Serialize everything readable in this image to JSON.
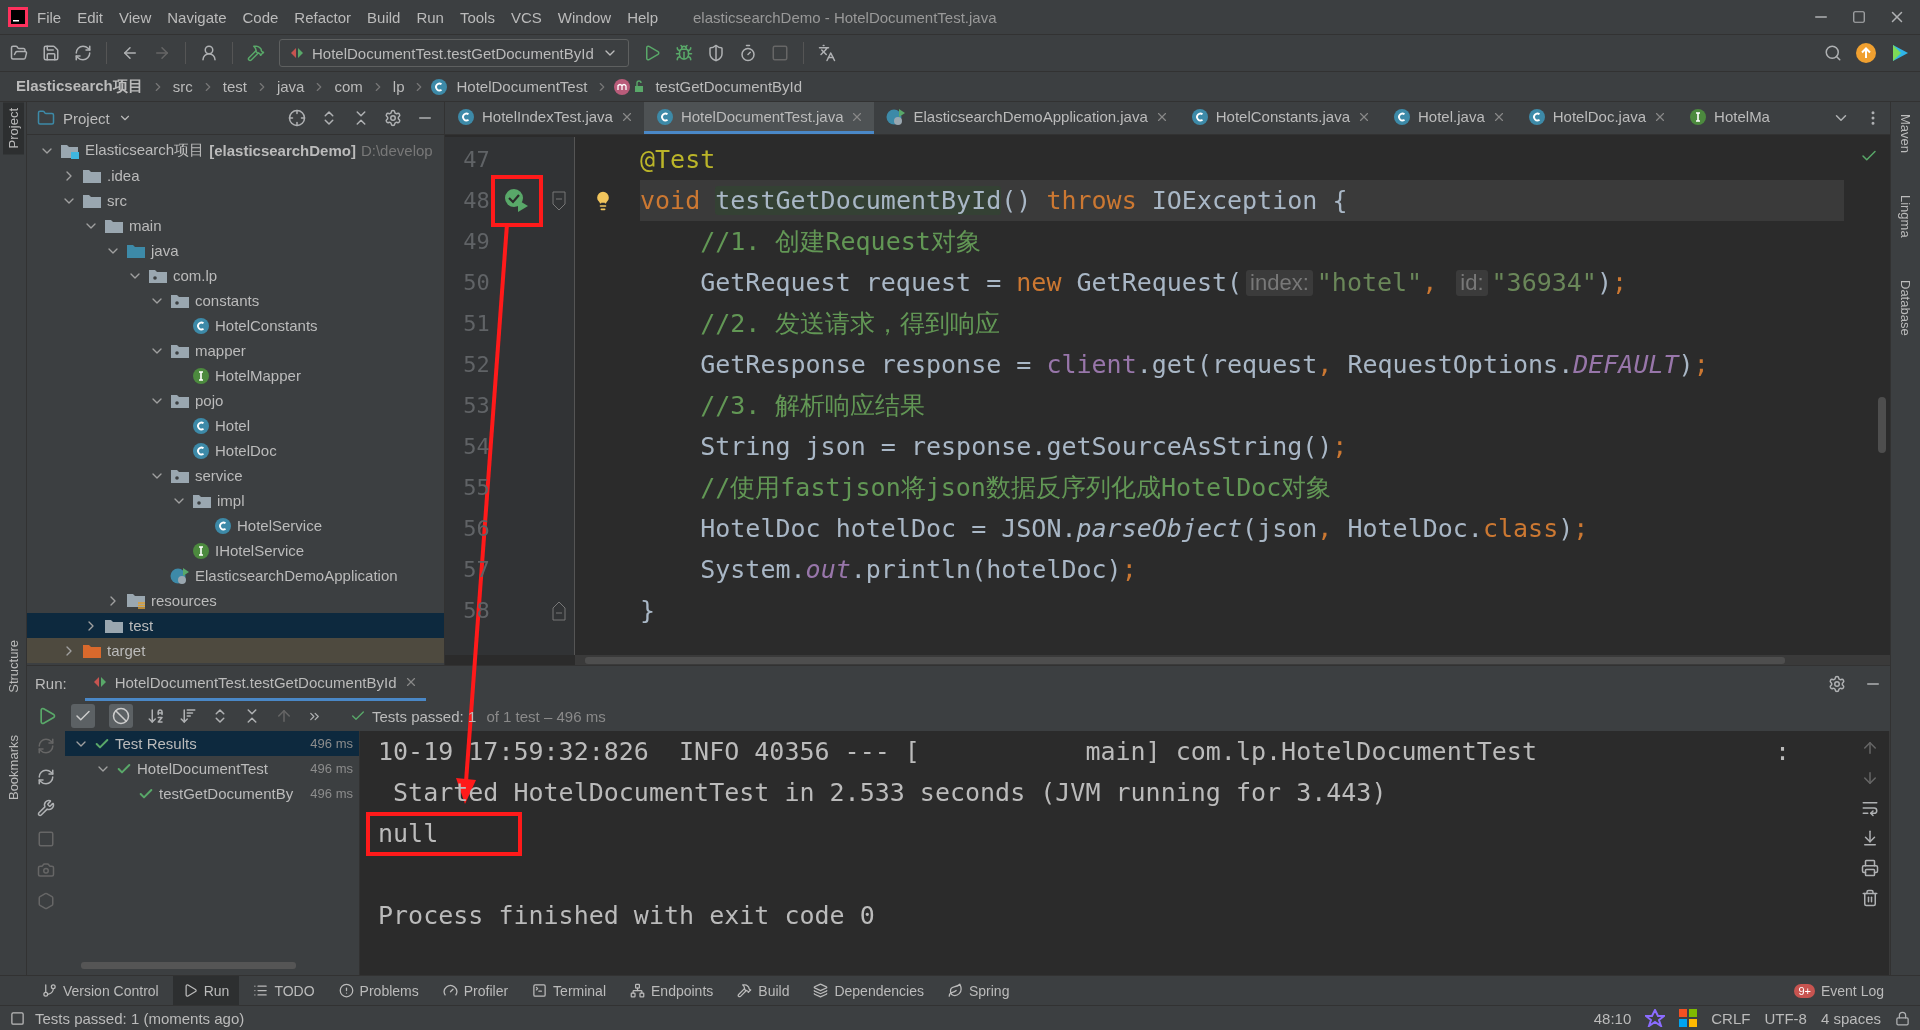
{
  "menu": [
    "File",
    "Edit",
    "View",
    "Navigate",
    "Code",
    "Refactor",
    "Build",
    "Run",
    "Tools",
    "VCS",
    "Window",
    "Help"
  ],
  "window": {
    "title": "elasticsearchDemo - HotelDocumentTest.java"
  },
  "toolbar": {
    "run_config": "HotelDocumentTest.testGetDocumentById"
  },
  "breadcrumb": [
    {
      "label": "Elasticsearch项目",
      "kind": "project"
    },
    {
      "label": "src",
      "kind": "dir"
    },
    {
      "label": "test",
      "kind": "dir"
    },
    {
      "label": "java",
      "kind": "dir"
    },
    {
      "label": "com",
      "kind": "dir"
    },
    {
      "label": "lp",
      "kind": "dir"
    },
    {
      "label": "HotelDocumentTest",
      "kind": "class"
    },
    {
      "label": "testGetDocumentById",
      "kind": "method"
    }
  ],
  "left_stripe": [
    {
      "label": "Project",
      "selected": true
    },
    {
      "label": "Structure",
      "selected": false
    },
    {
      "label": "Bookmarks",
      "selected": false
    }
  ],
  "right_stripe": [
    "Maven",
    "Lingma",
    "Database"
  ],
  "project": {
    "title": "Project",
    "tree": [
      {
        "label": "Elasticsearch项目",
        "module": "[elasticsearchDemo]",
        "path": "D:\\develop",
        "kind": "module",
        "expanded": true,
        "selected": false,
        "children": [
          {
            "label": ".idea",
            "kind": "folder",
            "expanded": false,
            "selected": false
          },
          {
            "label": "src",
            "kind": "folder",
            "expanded": true,
            "selected": false,
            "children": [
              {
                "label": "main",
                "kind": "folder",
                "expanded": true,
                "selected": false,
                "children": [
                  {
                    "label": "java",
                    "kind": "source",
                    "expanded": true,
                    "selected": false,
                    "children": [
                      {
                        "label": "com.lp",
                        "kind": "package",
                        "expanded": true,
                        "selected": false,
                        "children": [
                          {
                            "label": "constants",
                            "kind": "package",
                            "expanded": true,
                            "selected": false,
                            "children": [
                              {
                                "label": "HotelConstants",
                                "kind": "class",
                                "selected": false
                              }
                            ]
                          },
                          {
                            "label": "mapper",
                            "kind": "package",
                            "expanded": true,
                            "selected": false,
                            "children": [
                              {
                                "label": "HotelMapper",
                                "kind": "interface",
                                "selected": false
                              }
                            ]
                          },
                          {
                            "label": "pojo",
                            "kind": "package",
                            "expanded": true,
                            "selected": false,
                            "children": [
                              {
                                "label": "Hotel",
                                "kind": "class",
                                "selected": false
                              },
                              {
                                "label": "HotelDoc",
                                "kind": "class",
                                "selected": false
                              }
                            ]
                          },
                          {
                            "label": "service",
                            "kind": "package",
                            "expanded": true,
                            "selected": false,
                            "children": [
                              {
                                "label": "impl",
                                "kind": "package",
                                "expanded": true,
                                "selected": false,
                                "children": [
                                  {
                                    "label": "HotelService",
                                    "kind": "class",
                                    "selected": false
                                  }
                                ]
                              },
                              {
                                "label": "IHotelService",
                                "kind": "interface",
                                "selected": false
                              }
                            ]
                          },
                          {
                            "label": "ElasticsearchDemoApplication",
                            "kind": "app",
                            "selected": false
                          }
                        ]
                      }
                    ]
                  },
                  {
                    "label": "resources",
                    "kind": "resources",
                    "expanded": false,
                    "selected": false
                  }
                ]
              },
              {
                "label": "test",
                "kind": "folder",
                "expanded": false,
                "selected": true
              }
            ]
          },
          {
            "label": "target",
            "kind": "excluded",
            "expanded": false,
            "selected": false
          }
        ]
      }
    ]
  },
  "editor": {
    "tabs": [
      {
        "label": "HotelIndexTest.java",
        "kind": "class",
        "selected": false,
        "closable": true
      },
      {
        "label": "HotelDocumentTest.java",
        "kind": "class",
        "selected": true,
        "closable": true
      },
      {
        "label": "ElasticsearchDemoApplication.java",
        "kind": "app",
        "selected": false,
        "closable": true
      },
      {
        "label": "HotelConstants.java",
        "kind": "class",
        "selected": false,
        "closable": true
      },
      {
        "label": "Hotel.java",
        "kind": "class",
        "selected": false,
        "closable": true
      },
      {
        "label": "HotelDoc.java",
        "kind": "class",
        "selected": false,
        "closable": true
      },
      {
        "label": "HotelMa",
        "kind": "interface",
        "selected": false,
        "closable": false
      }
    ],
    "lines": [
      {
        "number": "47",
        "current": false,
        "tokens": [
          {
            "t": "@Test",
            "kind": "annotation"
          }
        ]
      },
      {
        "number": "48",
        "current": true,
        "run_icon": true,
        "marked": true,
        "fold_start": true,
        "bulb": true,
        "tokens": [
          {
            "t": "void ",
            "kind": "keyword"
          },
          {
            "t": "testGetDocumentById",
            "kind": "usage"
          },
          {
            "t": "() ",
            "kind": "plain"
          },
          {
            "t": "throws ",
            "kind": "keyword"
          },
          {
            "t": "IOException {",
            "kind": "plain"
          }
        ]
      },
      {
        "number": "49",
        "current": false,
        "tokens": [
          {
            "t": "    //1. 创建Request对象",
            "kind": "comment"
          }
        ]
      },
      {
        "number": "50",
        "current": false,
        "tokens": [
          {
            "t": "    GetRequest request = ",
            "kind": "plain"
          },
          {
            "t": "new ",
            "kind": "keyword"
          },
          {
            "t": "GetRequest(",
            "kind": "plain"
          },
          {
            "t": "index:",
            "kind": "hint"
          },
          {
            "t": "\"hotel\"",
            "kind": "string"
          },
          {
            "t": ", ",
            "kind": "punct"
          },
          {
            "t": "id:",
            "kind": "hint"
          },
          {
            "t": "\"36934\"",
            "kind": "string"
          },
          {
            "t": ")",
            "kind": "plain"
          },
          {
            "t": ";",
            "kind": "punct"
          }
        ]
      },
      {
        "number": "51",
        "current": false,
        "tokens": [
          {
            "t": "    //2. 发送请求，得到响应",
            "kind": "comment"
          }
        ]
      },
      {
        "number": "52",
        "current": false,
        "tokens": [
          {
            "t": "    GetResponse response = ",
            "kind": "plain"
          },
          {
            "t": "client",
            "kind": "field"
          },
          {
            "t": ".get(request",
            "kind": "plain"
          },
          {
            "t": ", ",
            "kind": "punct"
          },
          {
            "t": "RequestOptions.",
            "kind": "plain"
          },
          {
            "t": "DEFAULT",
            "kind": "constant"
          },
          {
            "t": ")",
            "kind": "plain"
          },
          {
            "t": ";",
            "kind": "punct"
          }
        ]
      },
      {
        "number": "53",
        "current": false,
        "tokens": [
          {
            "t": "    //3. 解析响应结果",
            "kind": "comment"
          }
        ]
      },
      {
        "number": "54",
        "current": false,
        "tokens": [
          {
            "t": "    String json = response.getSourceAsString()",
            "kind": "plain"
          },
          {
            "t": ";",
            "kind": "punct"
          }
        ]
      },
      {
        "number": "55",
        "current": false,
        "tokens": [
          {
            "t": "    //使用fastjson将json数据反序列化成HotelDoc对象",
            "kind": "comment"
          }
        ]
      },
      {
        "number": "56",
        "current": false,
        "tokens": [
          {
            "t": "    HotelDoc hotelDoc = JSON.",
            "kind": "plain"
          },
          {
            "t": "parseObject",
            "kind": "static"
          },
          {
            "t": "(json",
            "kind": "plain"
          },
          {
            "t": ", ",
            "kind": "punct"
          },
          {
            "t": "HotelDoc.",
            "kind": "plain"
          },
          {
            "t": "class",
            "kind": "keyword"
          },
          {
            "t": ")",
            "kind": "plain"
          },
          {
            "t": ";",
            "kind": "punct"
          }
        ]
      },
      {
        "number": "57",
        "current": false,
        "tokens": [
          {
            "t": "    System.",
            "kind": "plain"
          },
          {
            "t": "out",
            "kind": "constant"
          },
          {
            "t": ".println(hotelDoc)",
            "kind": "plain"
          },
          {
            "t": ";",
            "kind": "punct"
          }
        ]
      },
      {
        "number": "58",
        "current": false,
        "fold_end": true,
        "tokens": [
          {
            "t": "}",
            "kind": "plain"
          }
        ]
      }
    ]
  },
  "run": {
    "label": "Run:",
    "tab": "HotelDocumentTest.testGetDocumentById",
    "status": "Tests passed: 1",
    "status_detail": " of 1 test – 496 ms",
    "filters": [
      {
        "kind": "passed",
        "on": true
      },
      {
        "kind": "ignored",
        "on": true
      }
    ],
    "tests": [
      {
        "label": "Test Results",
        "time": "496 ms",
        "passed": true,
        "selected": true,
        "expanded": true,
        "children": [
          {
            "label": "HotelDocumentTest",
            "time": "496 ms",
            "passed": true,
            "selected": false,
            "expanded": true,
            "children": [
              {
                "label": "testGetDocumentBy",
                "time": "496 ms",
                "passed": true,
                "selected": false
              }
            ]
          }
        ]
      }
    ],
    "console": [
      {
        "kind": "log",
        "text": "10-19 17:59:32:826  INFO 40356 --- [           main] com.lp.HotelDocumentTest",
        "tail": ":",
        "highlighted": false
      },
      {
        "kind": "log",
        "text": " Started HotelDocumentTest in 2.533 seconds (JVM running for 3.443)",
        "highlighted": false
      },
      {
        "kind": "log",
        "text": "null",
        "highlighted": true
      },
      {
        "kind": "blank"
      },
      {
        "kind": "log",
        "text": "Process finished with exit code 0",
        "highlighted": false
      }
    ]
  },
  "tool_tabs": [
    {
      "label": "Version Control",
      "kind": "vcs",
      "selected": false
    },
    {
      "label": "Run",
      "kind": "run",
      "selected": true
    },
    {
      "label": "TODO",
      "kind": "todo",
      "selected": false
    },
    {
      "label": "Problems",
      "kind": "problems",
      "selected": false
    },
    {
      "label": "Profiler",
      "kind": "profiler",
      "selected": false
    },
    {
      "label": "Terminal",
      "kind": "terminal",
      "selected": false
    },
    {
      "label": "Endpoints",
      "kind": "endpoints",
      "selected": false
    },
    {
      "label": "Build",
      "kind": "build",
      "selected": false
    },
    {
      "label": "Dependencies",
      "kind": "dependencies",
      "selected": false
    },
    {
      "label": "Spring",
      "kind": "spring",
      "selected": false
    }
  ],
  "event_log": {
    "label": "Event Log",
    "badge": "9+"
  },
  "status_bar": {
    "message": "Tests passed: 1 (moments ago)",
    "position": "48:10",
    "line_ending": "CRLF",
    "encoding": "UTF-8",
    "indent": "4 spaces"
  }
}
